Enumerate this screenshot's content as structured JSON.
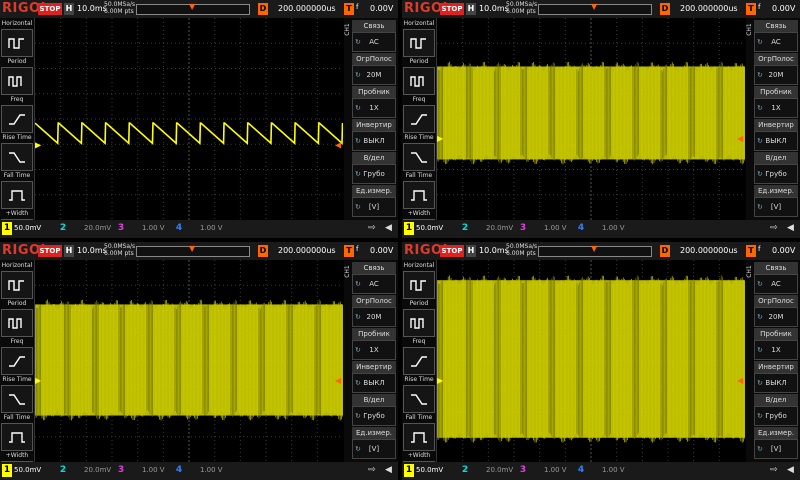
{
  "brand": "RIGOL",
  "status": "STOP",
  "h_label": "H",
  "timebase": "10.0ms",
  "sample_rate": "50.0MSa/s",
  "mem_depth": "6.00M pts",
  "d_label": "D",
  "delay": "200.000000us",
  "trig_label": "T",
  "trig_flag": "f",
  "trig_level": "0.00V",
  "left_menu": {
    "header": "Horizontal",
    "items": [
      {
        "label": "Period",
        "icon": "period-icon"
      },
      {
        "label": "Freq",
        "icon": "freq-icon"
      },
      {
        "label": "Rise Time",
        "icon": "rise-time-icon"
      },
      {
        "label": "Fall Time",
        "icon": "fall-time-icon"
      },
      {
        "label": "+Width",
        "icon": "pos-width-icon"
      },
      {
        "label": "-Width",
        "icon": "neg-width-icon"
      }
    ]
  },
  "right_menu": {
    "channel": "CH1",
    "items": [
      {
        "header": "Связь",
        "value": "AC"
      },
      {
        "header": "ОгрПолос",
        "value": "20M"
      },
      {
        "header": "Пробник",
        "value": "1X"
      },
      {
        "header": "Инвертир",
        "value": "ВЫКЛ"
      },
      {
        "header": "В/дел",
        "value": "Грубо"
      },
      {
        "header": "Ед.измер.",
        "value": "[V]"
      }
    ]
  },
  "channels": [
    {
      "num": "1",
      "scale": "50.0mV",
      "color": "#ffff00"
    },
    {
      "num": "2",
      "scale": "20.0mV",
      "color": "#00e0e0"
    },
    {
      "num": "3",
      "scale": "1.00 V",
      "color": "#e040e0"
    },
    {
      "num": "4",
      "scale": "1.00 V",
      "color": "#3080ff"
    }
  ],
  "panels": [
    {
      "id": "p1",
      "type": "sawtooth"
    },
    {
      "id": "p2",
      "type": "envelope",
      "top": 0.24,
      "bottom": 0.7
    },
    {
      "id": "p3",
      "type": "envelope",
      "top": 0.22,
      "bottom": 0.77
    },
    {
      "id": "p4",
      "type": "envelope",
      "top": 0.1,
      "bottom": 0.88
    }
  ]
}
